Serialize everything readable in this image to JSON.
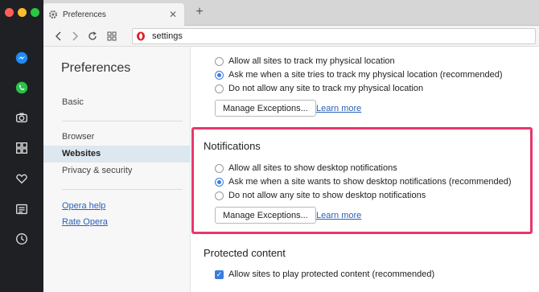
{
  "tab": {
    "title": "Preferences",
    "close": "✕",
    "new_tab": "+"
  },
  "address": {
    "value": "settings"
  },
  "sidebar": {
    "title": "Preferences",
    "items": [
      {
        "label": "Basic"
      },
      {
        "label": "Browser"
      },
      {
        "label": "Websites"
      },
      {
        "label": "Privacy & security"
      }
    ],
    "links": [
      {
        "label": "Opera help"
      },
      {
        "label": "Rate Opera"
      }
    ]
  },
  "location": {
    "options": [
      {
        "label": "Allow all sites to track my physical location",
        "selected": false
      },
      {
        "label": "Ask me when a site tries to track my physical location (recommended)",
        "selected": true
      },
      {
        "label": "Do not allow any site to track my physical location",
        "selected": false
      }
    ],
    "manage_label": "Manage Exceptions...",
    "learn_label": "Learn more"
  },
  "notifications": {
    "title": "Notifications",
    "options": [
      {
        "label": "Allow all sites to show desktop notifications",
        "selected": false
      },
      {
        "label": "Ask me when a site wants to show desktop notifications (recommended)",
        "selected": true
      },
      {
        "label": "Do not allow any site to show desktop notifications",
        "selected": false
      }
    ],
    "manage_label": "Manage Exceptions...",
    "learn_label": "Learn more"
  },
  "protected": {
    "title": "Protected content",
    "checkbox_label": "Allow sites to play protected content (recommended)",
    "checked": true
  },
  "colors": {
    "accent": "#3b7ddd",
    "highlight": "#e8376b",
    "link": "#2a62b9"
  }
}
